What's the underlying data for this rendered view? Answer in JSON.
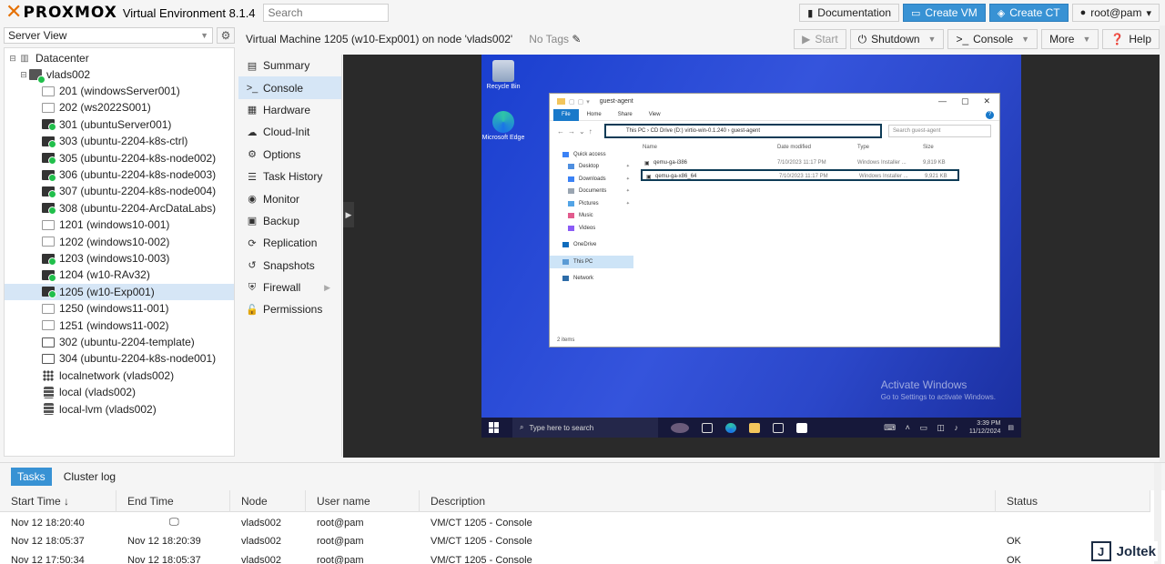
{
  "topbar": {
    "logo": "PROXMOX",
    "version": "Virtual Environment 8.1.4",
    "search_placeholder": "Search",
    "documentation": "Documentation",
    "create_vm": "Create VM",
    "create_ct": "Create CT",
    "user": "root@pam"
  },
  "tree": {
    "view": "Server View",
    "datacenter": "Datacenter",
    "node": "vlads002",
    "items": [
      {
        "label": "201 (windowsServer001)",
        "state": "off"
      },
      {
        "label": "202 (ws2022S001)",
        "state": "off"
      },
      {
        "label": "301 (ubuntuServer001)",
        "state": "on"
      },
      {
        "label": "303 (ubuntu-2204-k8s-ctrl)",
        "state": "on"
      },
      {
        "label": "305 (ubuntu-2204-k8s-node002)",
        "state": "on"
      },
      {
        "label": "306 (ubuntu-2204-k8s-node003)",
        "state": "on"
      },
      {
        "label": "307 (ubuntu-2204-k8s-node004)",
        "state": "on"
      },
      {
        "label": "308 (ubuntu-2204-ArcDataLabs)",
        "state": "on"
      },
      {
        "label": "1201 (windows10-001)",
        "state": "off"
      },
      {
        "label": "1202 (windows10-002)",
        "state": "off"
      },
      {
        "label": "1203 (windows10-003)",
        "state": "on"
      },
      {
        "label": "1204 (w10-RAv32)",
        "state": "on"
      },
      {
        "label": "1205 (w10-Exp001)",
        "state": "on"
      },
      {
        "label": "1250 (windows11-001)",
        "state": "off"
      },
      {
        "label": "1251 (windows11-002)",
        "state": "off"
      },
      {
        "label": "302 (ubuntu-2204-template)",
        "state": "tpl"
      },
      {
        "label": "304 (ubuntu-2204-k8s-node001)",
        "state": "tpl"
      },
      {
        "label": "localnetwork (vlads002)",
        "state": "net"
      },
      {
        "label": "local (vlads002)",
        "state": "db"
      },
      {
        "label": "local-lvm (vlads002)",
        "state": "db"
      }
    ]
  },
  "vmheader": {
    "title": "Virtual Machine 1205 (w10-Exp001) on node 'vlads002'",
    "tags": "No Tags",
    "start": "Start",
    "shutdown": "Shutdown",
    "console": "Console",
    "more": "More",
    "help": "Help"
  },
  "menu": [
    {
      "label": "Summary",
      "icon": "▤"
    },
    {
      "label": "Console",
      "icon": ">_"
    },
    {
      "label": "Hardware",
      "icon": "▦"
    },
    {
      "label": "Cloud-Init",
      "icon": "☁"
    },
    {
      "label": "Options",
      "icon": "⚙"
    },
    {
      "label": "Task History",
      "icon": "☰"
    },
    {
      "label": "Monitor",
      "icon": "◉"
    },
    {
      "label": "Backup",
      "icon": "▣"
    },
    {
      "label": "Replication",
      "icon": "⟳"
    },
    {
      "label": "Snapshots",
      "icon": "↺"
    },
    {
      "label": "Firewall",
      "icon": "⛨"
    },
    {
      "label": "Permissions",
      "icon": "🔓"
    }
  ],
  "vm_screen": {
    "recycle_bin": "Recycle Bin",
    "edge": "Microsoft Edge",
    "explorer_title": "guest-agent",
    "ribbon": [
      "File",
      "Home",
      "Share",
      "View"
    ],
    "address": "This PC  ›  CD Drive (D:) virtio-win-0.1.240  ›  guest-agent",
    "search": "Search guest-agent",
    "nav": [
      "Quick access",
      "Desktop",
      "Downloads",
      "Documents",
      "Pictures",
      "Music",
      "Videos",
      "OneDrive",
      "This PC",
      "Network"
    ],
    "columns": [
      "Name",
      "Date modified",
      "Type",
      "Size"
    ],
    "files": [
      {
        "name": "qemu-ga-i386",
        "date": "7/10/2023 11:17 PM",
        "type": "Windows Installer ...",
        "size": "9,819 KB"
      },
      {
        "name": "qemu-ga-x86_64",
        "date": "7/10/2023 11:17 PM",
        "type": "Windows Installer ...",
        "size": "9,921 KB"
      }
    ],
    "status": "2 items",
    "activate_1": "Activate Windows",
    "activate_2": "Go to Settings to activate Windows.",
    "taskbar_search": "Type here to search",
    "time": "3:39 PM",
    "date": "11/12/2024"
  },
  "tasks": {
    "tab_tasks": "Tasks",
    "tab_cluster": "Cluster log",
    "headers": [
      "Start Time ↓",
      "End Time",
      "Node",
      "User name",
      "Description",
      "Status"
    ],
    "rows": [
      {
        "start": "Nov 12 18:20:40",
        "end": "",
        "node": "vlads002",
        "user": "root@pam",
        "desc": "VM/CT 1205 - Console",
        "status": ""
      },
      {
        "start": "Nov 12 18:05:37",
        "end": "Nov 12 18:20:39",
        "node": "vlads002",
        "user": "root@pam",
        "desc": "VM/CT 1205 - Console",
        "status": "OK"
      },
      {
        "start": "Nov 12 17:50:34",
        "end": "Nov 12 18:05:37",
        "node": "vlads002",
        "user": "root@pam",
        "desc": "VM/CT 1205 - Console",
        "status": "OK"
      }
    ]
  },
  "watermark": "Joltek"
}
